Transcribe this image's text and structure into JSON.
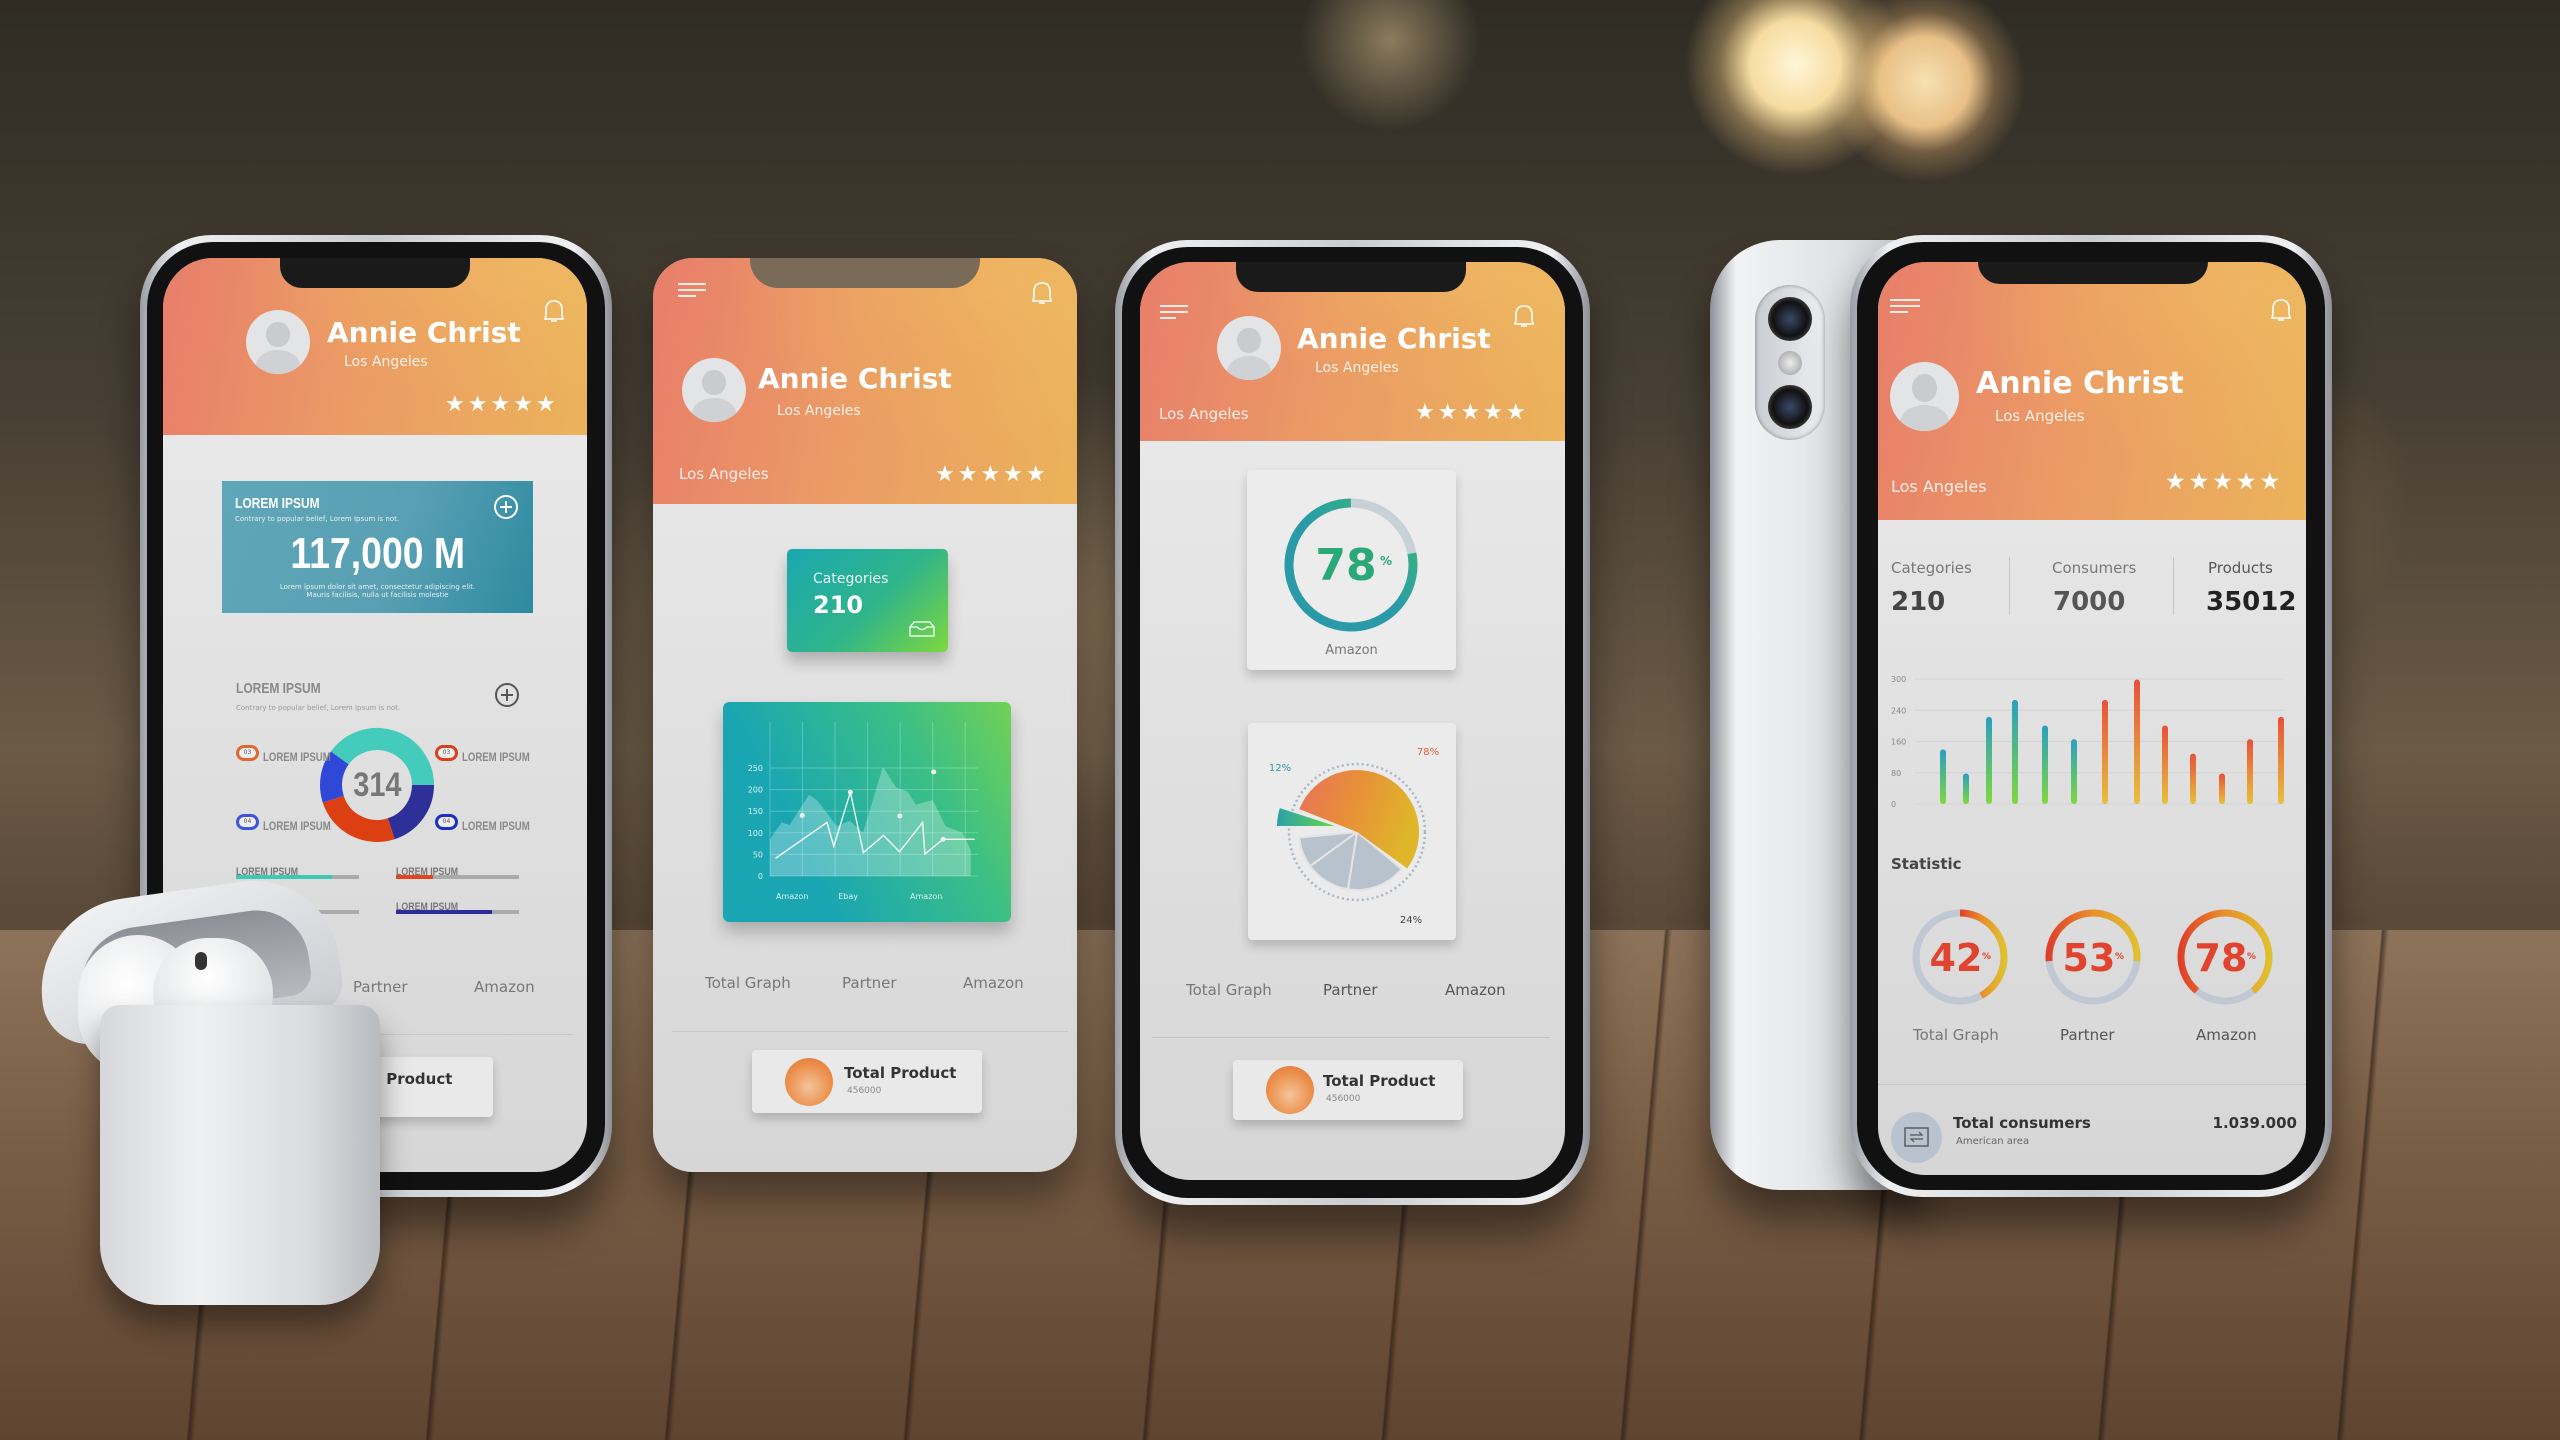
{
  "user": {
    "name": "Annie Christ",
    "city": "Los Angeles",
    "rating_stars": 5,
    "star_glyphs": "★★★★★"
  },
  "tabs": [
    "Total Graph",
    "Partner",
    "Amazon"
  ],
  "total_product": {
    "label": "Total Product",
    "value": "456000"
  },
  "phone1": {
    "card1": {
      "title": "LOREM IPSUM",
      "subtitle": "Contrary to popular belief, Lorem Ipsum is not.",
      "value": "117,000 M",
      "desc_line1": "Lorem ipsum dolor sit amet, consectetur adipiscing elit.",
      "desc_line2": "Mauris facilisis, nulla ut facilisis molestie"
    },
    "section2": {
      "title": "LOREM IPSUM",
      "subtitle": "Contrary to popular belief, Lorem Ipsum is not.",
      "donut_value": "314"
    },
    "legend": [
      {
        "badge": "03",
        "label": "LOREM IPSUM",
        "color": "#e2672f"
      },
      {
        "badge": "03",
        "label": "LOREM IPSUM",
        "color": "#d9401b"
      },
      {
        "badge": "04",
        "label": "LOREM IPSUM",
        "color": "#3d55d8"
      },
      {
        "badge": "04",
        "label": "LOREM IPSUM",
        "color": "#1f2fc4"
      }
    ],
    "progress": [
      {
        "label": "LOREM IPSUM",
        "value": 0.78,
        "color": "#3ec9b4"
      },
      {
        "label": "LOREM IPSUM",
        "value": 0.3,
        "color": "#e0471e"
      },
      {
        "label": "LOREM IPSUM",
        "value": 0.4,
        "color": "#3a5be6"
      },
      {
        "label": "LOREM IPSUM",
        "value": 0.78,
        "color": "#2c2d96"
      }
    ]
  },
  "phone2": {
    "categories": {
      "label": "Categories",
      "value": "210"
    }
  },
  "phone4": {
    "stats": [
      {
        "label": "Categories",
        "value": "210"
      },
      {
        "label": "Consumers",
        "value": "7000"
      },
      {
        "label": "Products",
        "value": "35012"
      }
    ],
    "statistic_title": "Statistic",
    "footer": {
      "title": "Total consumers",
      "subtitle": "American area",
      "value": "1.039.000"
    }
  },
  "colors": {
    "header_start": "#e87e6a",
    "header_end": "#ebb35a",
    "accent_teal": "#2aa3a8",
    "accent_green": "#7dd94a",
    "accent_red": "#e0462a"
  },
  "chart_data": [
    {
      "id": "phone1-donut",
      "type": "pie",
      "center_label": "314",
      "segments": [
        {
          "value": 0.4,
          "color": "#45cbbb"
        },
        {
          "value": 0.2,
          "color": "#2f2f9a"
        },
        {
          "value": 0.25,
          "color": "#dc3f12"
        },
        {
          "value": 0.15,
          "color": "#2f48d8"
        }
      ]
    },
    {
      "id": "phone2-line",
      "type": "line",
      "yticks": [
        0,
        50,
        100,
        150,
        200,
        250
      ],
      "ylim": [
        0,
        250
      ],
      "xtick_labels": [
        {
          "label": "Amazon",
          "x": 0.68
        },
        {
          "label": "Ebay",
          "x": 2.4
        },
        {
          "label": "Amazon",
          "x": 4.8
        }
      ],
      "xlim": [
        0,
        6.3
      ],
      "grid": true,
      "line": [
        [
          0.17,
          41
        ],
        [
          1.75,
          124
        ],
        [
          1.96,
          69
        ],
        [
          2.47,
          194
        ],
        [
          2.87,
          54
        ],
        [
          3.49,
          94
        ],
        [
          3.98,
          56
        ],
        [
          4.69,
          124
        ],
        [
          4.76,
          51
        ],
        [
          5.32,
          85
        ],
        [
          6.29,
          85
        ]
      ],
      "points": [
        [
          0.99,
          140
        ],
        [
          2.47,
          194
        ],
        [
          3.99,
          139
        ],
        [
          5.03,
          241
        ],
        [
          5.32,
          85
        ]
      ],
      "area": [
        [
          0.0,
          85
        ],
        [
          0.36,
          124
        ],
        [
          0.6,
          118
        ],
        [
          1.2,
          188
        ],
        [
          1.45,
          175
        ],
        [
          2.06,
          115
        ],
        [
          2.45,
          128
        ],
        [
          2.86,
          100
        ],
        [
          3.47,
          253
        ],
        [
          3.88,
          205
        ],
        [
          4.23,
          195
        ],
        [
          4.49,
          165
        ],
        [
          5.0,
          176
        ],
        [
          5.4,
          115
        ],
        [
          5.91,
          100
        ],
        [
          6.17,
          60
        ],
        [
          6.17,
          0
        ],
        [
          0,
          0
        ]
      ]
    },
    {
      "id": "phone3-gauge",
      "type": "pie",
      "value": 78,
      "label": "Amazon"
    },
    {
      "id": "phone3-pie",
      "type": "pie",
      "labels": [
        "78%",
        "12%",
        "24%"
      ],
      "values": [
        78,
        12,
        24
      ]
    },
    {
      "id": "phone4-bars",
      "type": "bar",
      "yticks": [
        0,
        80,
        160,
        240,
        300
      ],
      "grid": true,
      "values": [
        140,
        78,
        223,
        260,
        201,
        166,
        260,
        299,
        201,
        129,
        78,
        166,
        223
      ],
      "colors": [
        "teal",
        "teal",
        "teal",
        "teal",
        "teal",
        "teal",
        "orange",
        "orange",
        "orange",
        "orange",
        "orange",
        "orange",
        "orange"
      ]
    },
    {
      "id": "phone4-rings",
      "type": "pie",
      "items": [
        {
          "value": 42,
          "label": "Total Graph"
        },
        {
          "value": 53,
          "label": "Partner"
        },
        {
          "value": 78,
          "label": "Amazon"
        }
      ]
    }
  ]
}
